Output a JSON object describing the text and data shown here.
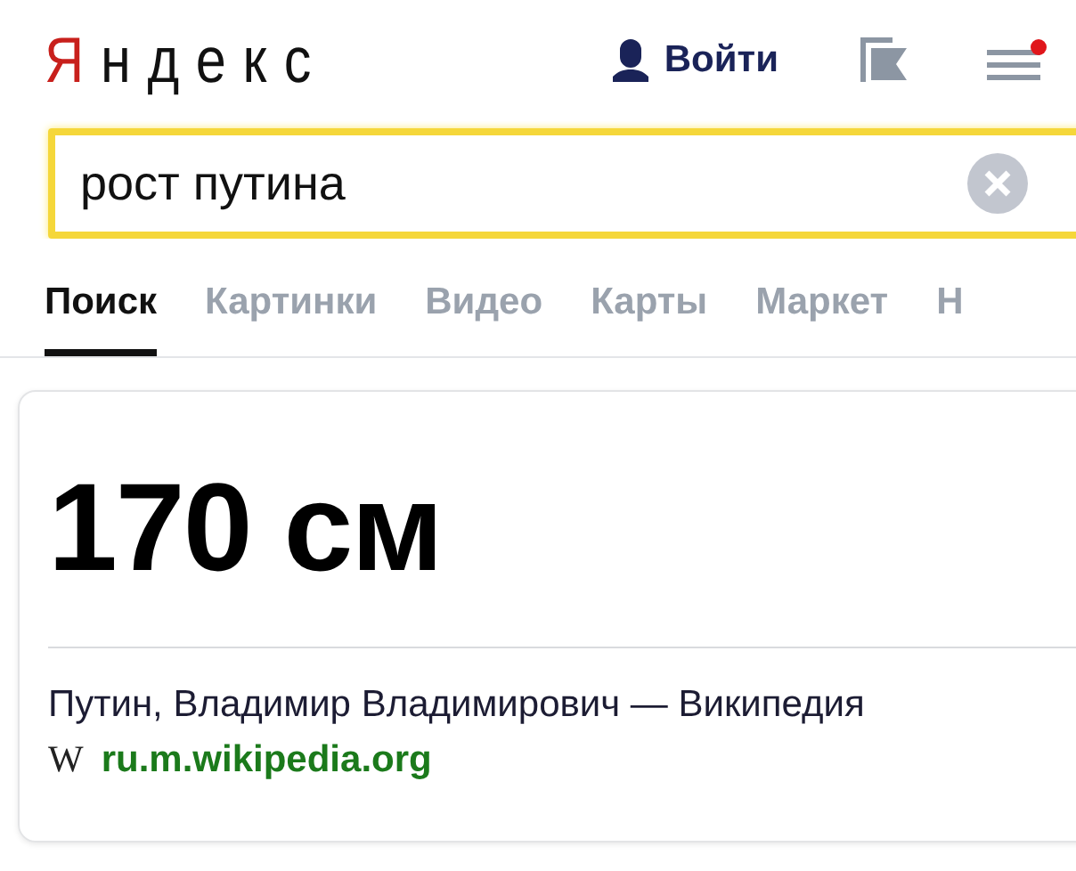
{
  "header": {
    "logo": "Яндекс",
    "login": "Войти",
    "menu_notification": true
  },
  "search": {
    "value": "рост путина"
  },
  "tabs": [
    {
      "label": "Поиск",
      "selected": true
    },
    {
      "label": "Картинки",
      "selected": false
    },
    {
      "label": "Видео",
      "selected": false
    },
    {
      "label": "Карты",
      "selected": false
    },
    {
      "label": "Маркет",
      "selected": false
    },
    {
      "label": "Н",
      "selected": false
    }
  ],
  "answer": {
    "value": "170 см",
    "source_title": "Путин, Владимир Владимирович — Википедия",
    "favicon": "W",
    "source_url": "ru.m.wikipedia.org"
  }
}
